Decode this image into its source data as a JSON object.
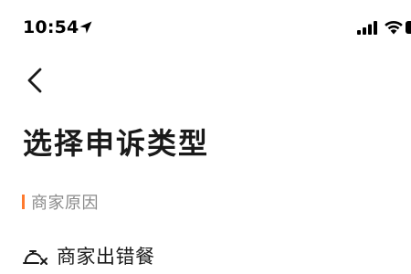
{
  "status_bar": {
    "time": "10:54",
    "icons": [
      "location-arrow-icon",
      "signal-icon",
      "wifi-icon",
      "battery-icon"
    ]
  },
  "nav": {
    "back_icon": "chevron-left-icon"
  },
  "page": {
    "title": "选择申诉类型"
  },
  "section": {
    "label": "商家原因",
    "accent_color": "#ff7a2e"
  },
  "options": [
    {
      "label": "商家出错餐",
      "icon": "dish-cover-wrong-icon"
    }
  ]
}
